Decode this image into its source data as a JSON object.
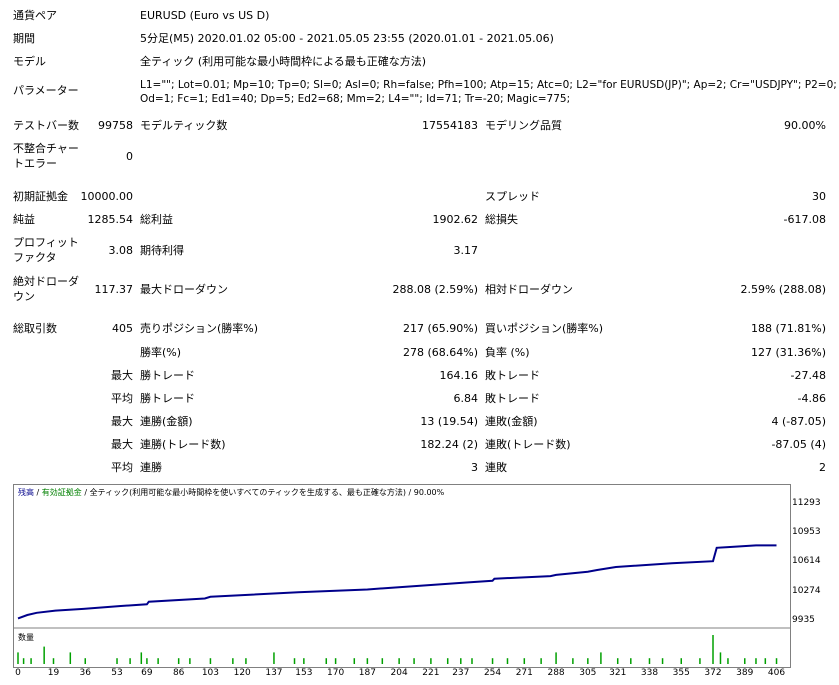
{
  "rows": {
    "symbol": {
      "label": "通貨ペア",
      "value": "EURUSD (Euro vs US D)"
    },
    "period": {
      "label": "期間",
      "value": "5分足(M5) 2020.01.02 05:00 - 2021.05.05 23:55 (2020.01.01 - 2021.05.06)"
    },
    "model": {
      "label": "モデル",
      "value": "全ティック (利用可能な最小時間枠による最も正確な方法)"
    },
    "params": {
      "label": "パラメーター",
      "line1": "L1=\"\"; Lot=0.01; Mp=10; Tp=0; Sl=0; Asl=0; Rh=false; Pfh=100; Atp=15; Atc=0; L2=\"for EURUSD(JP)\"; Ap=2; Cr=\"USDJPY\"; P2=0; L3=\"\";",
      "line2": "Od=1; Fc=1; Ed1=40; Dp=5; Ed2=68; Mm=2; L4=\"\"; Id=71; Tr=-20; Magic=775;"
    }
  },
  "stats": {
    "bars_label": "テストバー数",
    "bars": "99758",
    "ticks_label": "モデルティック数",
    "ticks": "17554183",
    "quality_label": "モデリング品質",
    "quality": "90.00%",
    "mismatch_label": "不整合チャートエラー",
    "mismatch": "0",
    "deposit_label": "初期証拠金",
    "deposit": "10000.00",
    "spread_label": "スプレッド",
    "spread": "30",
    "net_label": "純益",
    "net": "1285.54",
    "gross_profit_label": "総利益",
    "gross_profit": "1902.62",
    "gross_loss_label": "総損失",
    "gross_loss": "-617.08",
    "pf_label": "プロフィットファクタ",
    "pf": "3.08",
    "payoff_label": "期待利得",
    "payoff": "3.17",
    "abs_dd_label": "絶対ドローダウン",
    "abs_dd": "117.37",
    "max_dd_label": "最大ドローダウン",
    "max_dd": "288.08 (2.59%)",
    "rel_dd_label": "相対ドローダウン",
    "rel_dd": "2.59% (288.08)",
    "trades_label": "総取引数",
    "trades": "405",
    "short_label": "売りポジション(勝率%)",
    "short": "217 (65.90%)",
    "long_label": "買いポジション(勝率%)",
    "long": "188 (71.81%)",
    "win_rate_label": "勝率(%)",
    "win_rate": "278 (68.64%)",
    "loss_rate_label": "負率 (%)",
    "loss_rate": "127 (31.36%)",
    "max_word": "最大",
    "avg_word": "平均",
    "win_trade_label": "勝トレード",
    "loss_trade_label": "敗トレード",
    "largest_win": "164.16",
    "largest_loss": "-27.48",
    "avg_win": "6.84",
    "avg_loss": "-4.86",
    "consec_win_amt_label": "連勝(金額)",
    "consec_win_amt": "13 (19.54)",
    "consec_loss_amt_label": "連敗(金額)",
    "consec_loss_amt": "4 (-87.05)",
    "consec_win_trd_label": "連勝(トレード数)",
    "consec_win_trd": "182.24 (2)",
    "consec_loss_trd_label": "連敗(トレード数)",
    "consec_loss_trd": "-87.05 (4)",
    "avg_consec_win_label": "連勝",
    "avg_consec_win": "3",
    "avg_consec_loss_label": "連敗",
    "avg_consec_loss": "2"
  },
  "chart": {
    "legend_balance": "残高",
    "legend_sep": " / ",
    "legend_equity": "有効証拠金",
    "legend_rest": " / 全ティック(利用可能な最小時間枠を使いすべてのティックを生成する、最も正確な方法) / 90.00%",
    "volume_label": "数量",
    "line_color": "#00008b",
    "volume_color": "#00a000",
    "y_ticks": [
      "11293",
      "10953",
      "10614",
      "10274",
      "9935"
    ],
    "x_ticks": [
      "0",
      "19",
      "36",
      "53",
      "69",
      "86",
      "103",
      "120",
      "137",
      "153",
      "170",
      "187",
      "204",
      "221",
      "237",
      "254",
      "271",
      "288",
      "305",
      "321",
      "338",
      "355",
      "372",
      "389",
      "406"
    ]
  },
  "chart_data": {
    "type": "line",
    "series": [
      {
        "name": "残高",
        "x": [
          0,
          5,
          10,
          20,
          35,
          55,
          69,
          70,
          100,
          103,
          150,
          187,
          200,
          240,
          254,
          255,
          285,
          288,
          305,
          310,
          320,
          350,
          372,
          374,
          380,
          395,
          406
        ],
        "y": [
          9965,
          10005,
          10030,
          10055,
          10075,
          10108,
          10128,
          10158,
          10195,
          10215,
          10268,
          10300,
          10320,
          10380,
          10400,
          10425,
          10455,
          10468,
          10505,
          10525,
          10560,
          10603,
          10627,
          10782,
          10790,
          10810,
          10810
        ]
      }
    ],
    "volume": {
      "x": [
        0,
        3,
        7,
        14,
        19,
        28,
        36,
        53,
        60,
        66,
        69,
        75,
        86,
        92,
        103,
        115,
        122,
        137,
        148,
        153,
        165,
        170,
        180,
        187,
        195,
        204,
        212,
        221,
        230,
        237,
        243,
        254,
        262,
        271,
        280,
        288,
        297,
        305,
        312,
        321,
        328,
        338,
        345,
        355,
        365,
        372,
        376,
        380,
        389,
        395,
        400,
        406
      ],
      "y": [
        2,
        1,
        1,
        3,
        1,
        2,
        1,
        1,
        1,
        2,
        1,
        1,
        1,
        1,
        1,
        1,
        1,
        2,
        1,
        1,
        1,
        1,
        1,
        1,
        1,
        1,
        1,
        1,
        1,
        1,
        1,
        1,
        1,
        1,
        1,
        2,
        1,
        1,
        2,
        1,
        1,
        1,
        1,
        1,
        1,
        5,
        2,
        1,
        1,
        1,
        1,
        1
      ]
    },
    "y_range": [
      9935,
      11393
    ],
    "x_range": [
      0,
      410
    ]
  }
}
